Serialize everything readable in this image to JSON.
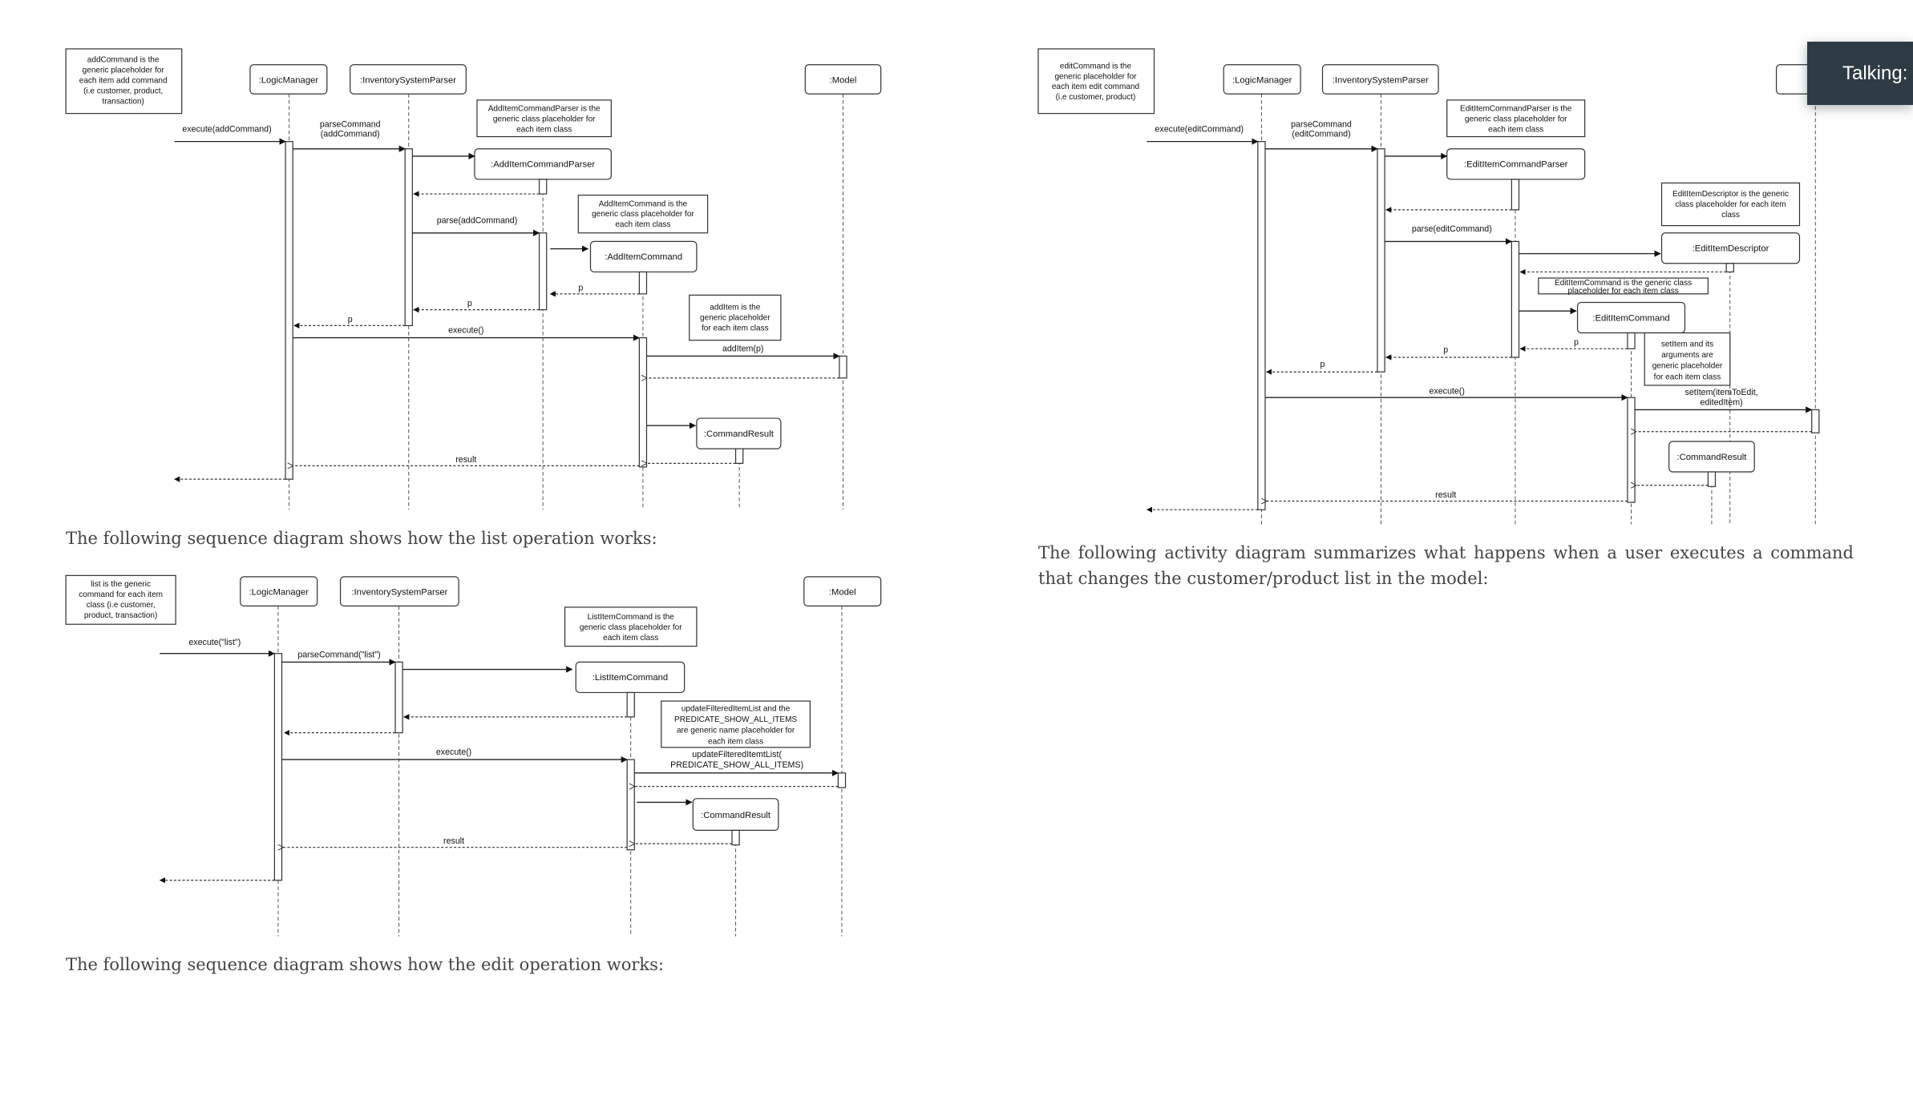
{
  "add_diagram": {
    "note": [
      "addCommand is the",
      "generic placeholder  for",
      "each item add command",
      "(i.e customer, product,",
      "transaction)"
    ],
    "logic_manager": ":LogicManager",
    "parser": ":InventorySystemParser",
    "model": ":Model",
    "item_parser_note": [
      "AddItemCommandParser is the",
      "generic class placeholder for",
      "each item class"
    ],
    "item_parser": ":AddItemCommandParser",
    "item_command_note": [
      "AddItemCommand is the",
      "generic class placeholder for",
      "each item class"
    ],
    "item_command": ":AddItemCommand",
    "add_item_note": [
      "addItem is the",
      "generic placeholder",
      "for each item class"
    ],
    "command_result": ":CommandResult",
    "msg_execute": "execute(addCommand)",
    "msg_parse_command": [
      "parseCommand",
      "(addCommand)"
    ],
    "msg_parse": "parse(addCommand)",
    "ret_p": "p",
    "msg_execute2": "execute()",
    "msg_add_item": "addItem(p)",
    "ret_result": "result"
  },
  "list_caption": "The following sequence diagram shows how the list operation works:",
  "list_diagram": {
    "note": [
      "list is the generic",
      "command for each item",
      "class (i.e customer,",
      "product, transaction)"
    ],
    "logic_manager": ":LogicManager",
    "parser": ":InventorySystemParser",
    "model": ":Model",
    "item_command_note": [
      "ListItemCommand is the",
      "generic class placeholder for",
      "each item class"
    ],
    "item_command": ":ListItemCommand",
    "update_note": [
      "updateFilteredItemList and the",
      "PREDICATE_SHOW_ALL_ITEMS",
      "are generic name placeholder for",
      "each item class"
    ],
    "command_result": ":CommandResult",
    "msg_execute": "execute(\"list\")",
    "msg_parse_command": "parseCommand(\"list\")",
    "msg_execute2": "execute()",
    "msg_update": [
      "updateFilteredItemtList(",
      "PREDICATE_SHOW_ALL_ITEMS)"
    ],
    "ret_result": "result"
  },
  "edit_caption": "The following sequence diagram shows how the edit operation works:",
  "edit_diagram": {
    "note": [
      "editCommand is the",
      "generic placeholder  for",
      "each item edit command",
      "(i.e customer, product)"
    ],
    "logic_manager": ":LogicManager",
    "parser": ":InventorySystemParser",
    "model": ":M",
    "item_parser_note": [
      "EditItemCommandParser is the",
      "generic class placeholder for",
      "each item class"
    ],
    "item_parser": ":EditItemCommandParser",
    "descriptor_note": [
      "EditItemDescriptor is the generic",
      "class placeholder for each item",
      "class"
    ],
    "descriptor": ":EditItemDescriptor",
    "item_command_note": [
      "EditItemCommand is the generic class",
      "placeholder for each item class"
    ],
    "item_command": ":EditItemCommand",
    "set_item_note": [
      "setItem and its",
      "arguments are",
      "generic placeholder",
      "for each item class"
    ],
    "command_result": ":CommandResult",
    "msg_execute": "execute(editCommand)",
    "msg_parse_command": [
      "parseCommand",
      "(editCommand)"
    ],
    "msg_parse": "parse(editCommand)",
    "ret_p": "p",
    "msg_execute2": "execute()",
    "msg_set_item": [
      "setItem(itemToEdit,",
      "editedItem)"
    ],
    "ret_result": "result"
  },
  "activity_caption": "The following activity diagram summarizes what happens when a user executes a command that changes the customer/product list in the model:",
  "overlay": {
    "label": "Talking:",
    "background": "#2e3a44"
  }
}
